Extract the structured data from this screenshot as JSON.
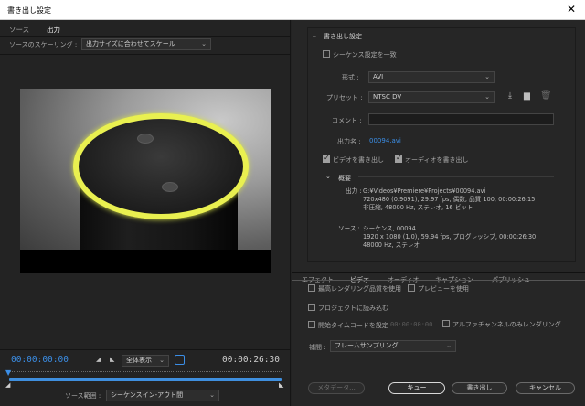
{
  "window": {
    "title": "書き出し設定",
    "close_glyph": "✕"
  },
  "source_tabs": [
    {
      "label": "ソース"
    },
    {
      "label": "出力"
    }
  ],
  "source_scaling": {
    "label": "ソースのスケーリング :",
    "value": "出力サイズに合わせてスケール"
  },
  "playback": {
    "current_time": "00:00:00:00",
    "duration": "00:00:26:30",
    "zoom": "全体表示",
    "source_range_label": "ソース範囲 :",
    "source_range_value": "シーケンスイン-アウト間",
    "playhead_fraction": 0.0
  },
  "export_settings": {
    "section_title": "書き出し設定",
    "match_sequence_label": "シーケンス設定を一致",
    "match_sequence_checked": false,
    "format_label": "形式 :",
    "format_value": "AVI",
    "preset_label": "プリセット :",
    "preset_value": "NTSC DV",
    "comment_label": "コメント :",
    "comment_value": "",
    "output_name_label": "出力名 :",
    "output_name_value": "00094.avi",
    "export_video_label": "ビデオを書き出し",
    "export_video_checked": true,
    "export_audio_label": "オーディオを書き出し",
    "export_audio_checked": true,
    "summary_title": "概要",
    "summary_output_label": "出力 :",
    "summary_output_lines": [
      "G:¥Videos¥Premiere¥Projects¥00094.avi",
      "720x480 (0.9091), 29.97 fps, 偶数, 品質 100, 00:00:26:15",
      "非圧縮, 48000 Hz, ステレオ, 16 ビット"
    ],
    "summary_source_label": "ソース :",
    "summary_source_lines": [
      "シーケンス, 00094",
      "1920 x 1080 (1.0), 59.94 fps, プログレッシブ, 00:00:26:30",
      "48000 Hz, ステレオ"
    ]
  },
  "bottom_tabs": [
    {
      "label": "エフェクト"
    },
    {
      "label": "ビデオ"
    },
    {
      "label": "オーディオ"
    },
    {
      "label": "キャプション"
    },
    {
      "label": "パブリッシュ"
    }
  ],
  "options": {
    "max_render_quality_label": "最高レンダリング品質を使用",
    "use_previews_label": "プレビューを使用",
    "import_into_project_label": "プロジェクトに読み込む",
    "set_start_timecode_label": "開始タイムコードを設定",
    "start_timecode_value": "00:00:00:00",
    "render_alpha_label": "アルファチャンネルのみレンダリング",
    "interpolation_label": "補間 :",
    "interpolation_value": "フレームサンプリング"
  },
  "buttons": {
    "metadata": "メタデータ...",
    "queue": "キュー",
    "export": "書き出し",
    "cancel": "キャンセル"
  },
  "icons": {
    "save_preset": "download-icon",
    "import_preset": "folder-icon",
    "delete_preset": "trash-icon",
    "crop": "crop-icon"
  },
  "colors": {
    "accent_blue": "#3b8ee6",
    "ring_yellow": "#e9f050"
  }
}
